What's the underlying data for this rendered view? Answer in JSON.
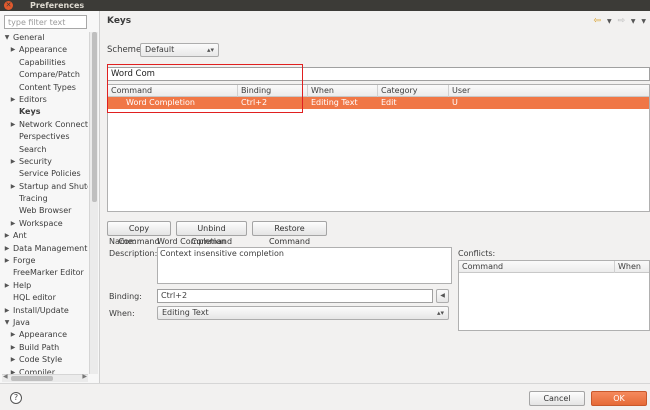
{
  "window": {
    "title": "Preferences"
  },
  "sidebar": {
    "filter_placeholder": "type filter text",
    "items": [
      {
        "label": "General",
        "level": 0,
        "arrow": "▼"
      },
      {
        "label": "Appearance",
        "level": 1,
        "arrow": "▶"
      },
      {
        "label": "Capabilities",
        "level": 1,
        "arrow": ""
      },
      {
        "label": "Compare/Patch",
        "level": 1,
        "arrow": ""
      },
      {
        "label": "Content Types",
        "level": 1,
        "arrow": ""
      },
      {
        "label": "Editors",
        "level": 1,
        "arrow": "▶"
      },
      {
        "label": "Keys",
        "level": 1,
        "arrow": "",
        "selected": true
      },
      {
        "label": "Network Connecti",
        "level": 1,
        "arrow": "▶"
      },
      {
        "label": "Perspectives",
        "level": 1,
        "arrow": ""
      },
      {
        "label": "Search",
        "level": 1,
        "arrow": ""
      },
      {
        "label": "Security",
        "level": 1,
        "arrow": "▶"
      },
      {
        "label": "Service Policies",
        "level": 1,
        "arrow": ""
      },
      {
        "label": "Startup and Shutd",
        "level": 1,
        "arrow": "▶"
      },
      {
        "label": "Tracing",
        "level": 1,
        "arrow": ""
      },
      {
        "label": "Web Browser",
        "level": 1,
        "arrow": ""
      },
      {
        "label": "Workspace",
        "level": 1,
        "arrow": "▶"
      },
      {
        "label": "Ant",
        "level": 0,
        "arrow": "▶"
      },
      {
        "label": "Data Management",
        "level": 0,
        "arrow": "▶"
      },
      {
        "label": "Forge",
        "level": 0,
        "arrow": "▶"
      },
      {
        "label": "FreeMarker Editor",
        "level": 0,
        "arrow": ""
      },
      {
        "label": "Help",
        "level": 0,
        "arrow": "▶"
      },
      {
        "label": "HQL editor",
        "level": 0,
        "arrow": ""
      },
      {
        "label": "Install/Update",
        "level": 0,
        "arrow": "▶"
      },
      {
        "label": "Java",
        "level": 0,
        "arrow": "▼"
      },
      {
        "label": "Appearance",
        "level": 1,
        "arrow": "▶"
      },
      {
        "label": "Build Path",
        "level": 1,
        "arrow": "▶"
      },
      {
        "label": "Code Style",
        "level": 1,
        "arrow": "▶"
      },
      {
        "label": "Compiler",
        "level": 1,
        "arrow": "▶"
      }
    ]
  },
  "main": {
    "title": "Keys",
    "scheme": {
      "label": "Scheme:",
      "value": "Default"
    },
    "filter_value": "Word Com",
    "table": {
      "columns": [
        "Command",
        "Binding",
        "When",
        "Category",
        "User"
      ],
      "rows": [
        [
          "Word Completion",
          "Ctrl+2",
          "Editing Text",
          "Edit",
          "U"
        ]
      ]
    },
    "buttons": {
      "copy": "Copy Command",
      "unbind": "Unbind Command",
      "restore": "Restore Command"
    },
    "details": {
      "name_label": "Name:",
      "name_value": "Word Completion",
      "description_label": "Description:",
      "description_value": "Context insensitive completion",
      "binding_label": "Binding:",
      "binding_value": "Ctrl+2",
      "when_label": "When:",
      "when_value": "Editing Text"
    },
    "conflicts": {
      "label": "Conflicts:",
      "columns": [
        "Command",
        "When"
      ]
    }
  },
  "footer": {
    "help": "?",
    "cancel": "Cancel",
    "ok": "OK"
  },
  "colors": {
    "accent": "#f07746",
    "titlebar": "#3c3b37",
    "highlight_box": "#e02020"
  }
}
